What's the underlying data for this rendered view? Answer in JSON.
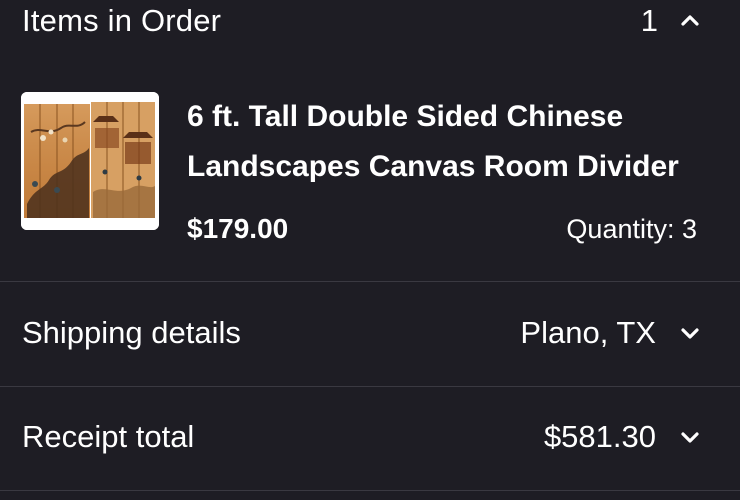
{
  "order": {
    "header": {
      "title": "Items in Order",
      "count": "1",
      "expand_icon": "chevron-up-icon"
    },
    "item": {
      "title": "6 ft. Tall Double Sided Chinese Landscapes Canvas Room Divider",
      "price": "$179.00",
      "quantity": "Quantity: 3"
    },
    "shipping": {
      "label": "Shipping details",
      "value": "Plano, TX",
      "icon": "chevron-down-icon"
    },
    "receipt": {
      "label": "Receipt total",
      "value": "$581.30",
      "icon": "chevron-down-icon"
    }
  },
  "colors": {
    "background": "#1e1d24",
    "text": "#ffffff",
    "divider": "#3a3941"
  }
}
